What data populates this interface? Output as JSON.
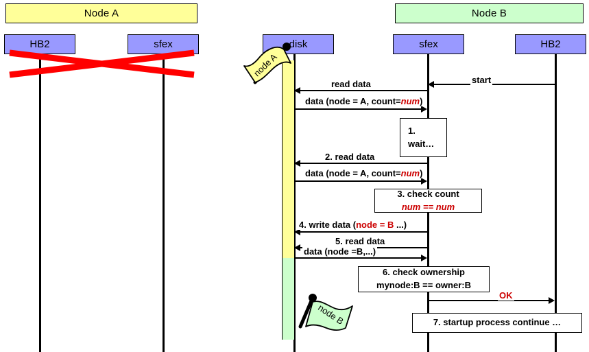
{
  "diagram": {
    "title_a": "Node A",
    "title_b": "Node B"
  },
  "panels": [
    {
      "name": "node-a",
      "banner": "Node A",
      "banner_color": "#ffff99",
      "status": "failed",
      "lifelines": [
        {
          "label": "HB2"
        },
        {
          "label": "sfex"
        }
      ]
    },
    {
      "name": "node-b",
      "banner": "Node B",
      "banner_color": "#ccffcc",
      "status": "active",
      "lifelines": [
        {
          "label": "disk"
        },
        {
          "label": "sfex"
        },
        {
          "label": "HB2"
        }
      ]
    }
  ],
  "lifeline_heads": {
    "a_hb2": "HB2",
    "a_sfex": "sfex",
    "b_disk": "disk",
    "b_sfex": "sfex",
    "b_hb2": "HB2"
  },
  "messages": [
    {
      "id": "start",
      "label": "start",
      "from": "hb2",
      "to": "sfex",
      "direction": "left"
    },
    {
      "id": "read-data-1",
      "label": "read data",
      "from": "sfex",
      "to": "disk",
      "direction": "left"
    },
    {
      "id": "data-1",
      "label": "data (node = A, count=",
      "label_emph": "num",
      "label_tail": ")",
      "from": "disk",
      "to": "sfex",
      "direction": "right"
    },
    {
      "id": "read-data-2",
      "label": "2. read data",
      "from": "sfex",
      "to": "disk",
      "direction": "left"
    },
    {
      "id": "data-2",
      "label": "data (node = A, count=",
      "label_emph": "num",
      "label_tail": ")",
      "from": "disk",
      "to": "sfex",
      "direction": "right"
    },
    {
      "id": "write-data",
      "label": "4. write data (",
      "label_emph": "node = B",
      "label_tail": " ...)",
      "from": "sfex",
      "to": "disk",
      "direction": "left"
    },
    {
      "id": "read-data-3",
      "label": "5. read data",
      "from": "sfex",
      "to": "disk",
      "direction": "left"
    },
    {
      "id": "data-3",
      "label": "data (node =B,...)",
      "from": "disk",
      "to": "sfex",
      "direction": "right"
    },
    {
      "id": "ok",
      "label": "OK",
      "from": "sfex",
      "to": "hb2",
      "direction": "right",
      "color": "#cc0000"
    }
  ],
  "message_labels": {
    "start": "start",
    "read_data_1": "read data",
    "data_prefix": "data (node = A, count=",
    "data_num": "num",
    "data_suffix": ")",
    "read_data_2": "2. read data",
    "write_data_prefix": "4. write data (",
    "write_data_emph": "node = B",
    "write_data_suffix": " ...)",
    "read_data_3": "5. read data",
    "data_node_b": "data (node =B,...)",
    "ok": "OK"
  },
  "notes": [
    {
      "id": "wait",
      "line1": "1.",
      "line2": "wait…",
      "align": "left"
    },
    {
      "id": "checkcount",
      "line1": "3. check count",
      "line2": "num == num",
      "align": "center",
      "line2_style": "red-italic"
    },
    {
      "id": "ownership",
      "line1": "6. check ownership",
      "line2": "mynode:B == owner:B",
      "align": "center"
    },
    {
      "id": "startup",
      "line1": "7. startup process continue …",
      "align": "center"
    }
  ],
  "note_text": {
    "wait_l1": "1.",
    "wait_l2": "wait…",
    "check_count_l1": "3. check count",
    "check_count_l2": "num == num",
    "ownership_l1": "6. check ownership",
    "ownership_l2": "mynode:B == owner:B",
    "startup_l1": "7. startup process continue …"
  },
  "flags": [
    {
      "id": "node-a",
      "label": "node A",
      "color": "#ffff99"
    },
    {
      "id": "node-b",
      "label": "node B",
      "color": "#ccffcc"
    }
  ],
  "flag_labels": {
    "node_a": "node A",
    "node_b": "node B"
  },
  "colors": {
    "lifeline_header": "#9999ff",
    "node_a_fill": "#ffff99",
    "node_b_fill": "#ccffcc",
    "accent_red": "#cc0000",
    "failure_cross": "#ff0000",
    "line": "#000000"
  }
}
